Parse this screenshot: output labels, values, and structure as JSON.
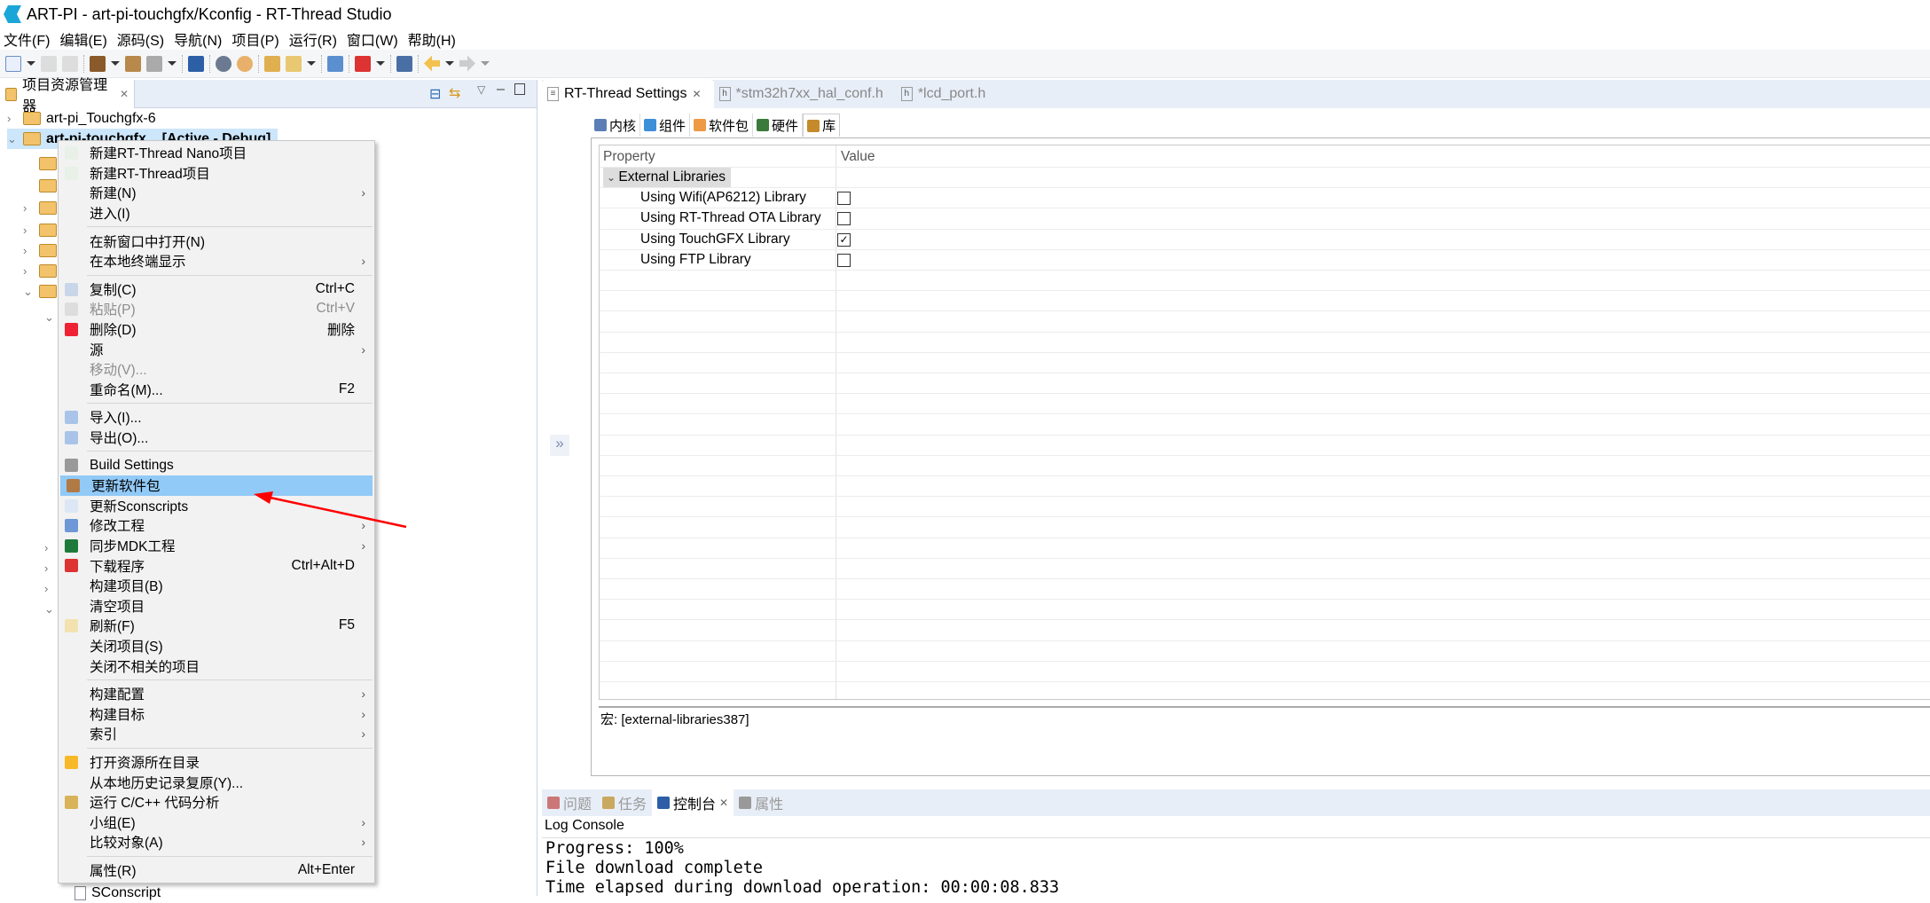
{
  "window": {
    "title": "ART-PI - art-pi-touchgfx/Kconfig - RT-Thread Studio"
  },
  "menubar": [
    "文件(F)",
    "编辑(E)",
    "源码(S)",
    "导航(N)",
    "项目(P)",
    "运行(R)",
    "窗口(W)",
    "帮助(H)"
  ],
  "explorer": {
    "tab_label": "项目资源管理器",
    "projects": [
      "art-pi_Touchgfx-6",
      "art-pi-touchgfx    [Active - Debug]"
    ],
    "bottom_item": "SConscript"
  },
  "context_menu": {
    "groups": [
      [
        {
          "label": "新建RT-Thread Nano项目",
          "icon": "new-project-icon"
        },
        {
          "label": "新建RT-Thread项目",
          "icon": "new-project-icon"
        },
        {
          "label": "新建(N)",
          "submenu": true
        },
        {
          "label": "进入(I)"
        }
      ],
      [
        {
          "label": "在新窗口中打开(N)"
        },
        {
          "label": "在本地终端显示",
          "submenu": true
        }
      ],
      [
        {
          "label": "复制(C)",
          "shortcut": "Ctrl+C",
          "icon": "copy-icon"
        },
        {
          "label": "粘贴(P)",
          "shortcut": "Ctrl+V",
          "icon": "paste-icon",
          "disabled": true
        },
        {
          "label": "删除(D)",
          "shortcut": "删除",
          "icon": "delete-icon"
        },
        {
          "label": "源",
          "submenu": true
        },
        {
          "label": "移动(V)...",
          "disabled": true
        },
        {
          "label": "重命名(M)...",
          "shortcut": "F2"
        }
      ],
      [
        {
          "label": "导入(I)...",
          "icon": "import-icon"
        },
        {
          "label": "导出(O)...",
          "icon": "export-icon"
        }
      ],
      [
        {
          "label": "Build Settings",
          "icon": "wrench-icon"
        },
        {
          "label": "更新软件包",
          "icon": "package-icon",
          "highlighted": true
        },
        {
          "label": "更新Sconscripts",
          "icon": "document-icon"
        },
        {
          "label": "修改工程",
          "icon": "wrench-blue-icon",
          "submenu": true
        },
        {
          "label": "同步MDK工程",
          "icon": "mdk-icon",
          "submenu": true
        },
        {
          "label": "下载程序",
          "shortcut": "Ctrl+Alt+D",
          "icon": "download-icon"
        },
        {
          "label": "构建项目(B)"
        },
        {
          "label": "清空项目"
        },
        {
          "label": "刷新(F)",
          "shortcut": "F5",
          "icon": "refresh-icon"
        },
        {
          "label": "关闭项目(S)"
        },
        {
          "label": "关闭不相关的项目"
        }
      ],
      [
        {
          "label": "构建配置",
          "submenu": true
        },
        {
          "label": "构建目标",
          "submenu": true
        },
        {
          "label": "索引",
          "submenu": true
        }
      ],
      [
        {
          "label": "打开资源所在目录",
          "icon": "folder-icon"
        },
        {
          "label": "从本地历史记录复原(Y)..."
        },
        {
          "label": "运行 C/C++ 代码分析",
          "icon": "analysis-icon"
        },
        {
          "label": "小组(E)",
          "submenu": true
        },
        {
          "label": "比较对象(A)",
          "submenu": true
        }
      ],
      [
        {
          "label": "属性(R)",
          "shortcut": "Alt+Enter"
        }
      ]
    ]
  },
  "editor": {
    "tabs": [
      {
        "label": "RT-Thread Settings",
        "active": true
      },
      {
        "label": "*stm32h7xx_hal_conf.h"
      },
      {
        "label": "*lcd_port.h"
      }
    ],
    "subtabs": [
      "内核",
      "组件",
      "软件包",
      "硬件",
      "库"
    ],
    "active_subtab": "库",
    "table": {
      "headers": [
        "Property",
        "Value"
      ],
      "group": "External Libraries",
      "rows": [
        {
          "label": "Using Wifi(AP6212) Library",
          "checked": false
        },
        {
          "label": "Using RT-Thread OTA Library",
          "checked": false
        },
        {
          "label": "Using TouchGFX Library",
          "checked": true
        },
        {
          "label": "Using FTP Library",
          "checked": false
        }
      ]
    },
    "macro": "宏: [external-libraries387]",
    "collapse_glyph": "»"
  },
  "bottom": {
    "tabs": [
      "问题",
      "任务",
      "控制台",
      "属性"
    ],
    "active": "控制台",
    "console_title": "Log Console",
    "lines": [
      "Progress: 100%",
      "File download complete",
      "Time elapsed during download operation: 00:00:08.833"
    ]
  },
  "colors": {
    "highlight": "#91c9f7",
    "annotation_arrow": "#ff0000",
    "panel_header": "#e8eef7"
  }
}
